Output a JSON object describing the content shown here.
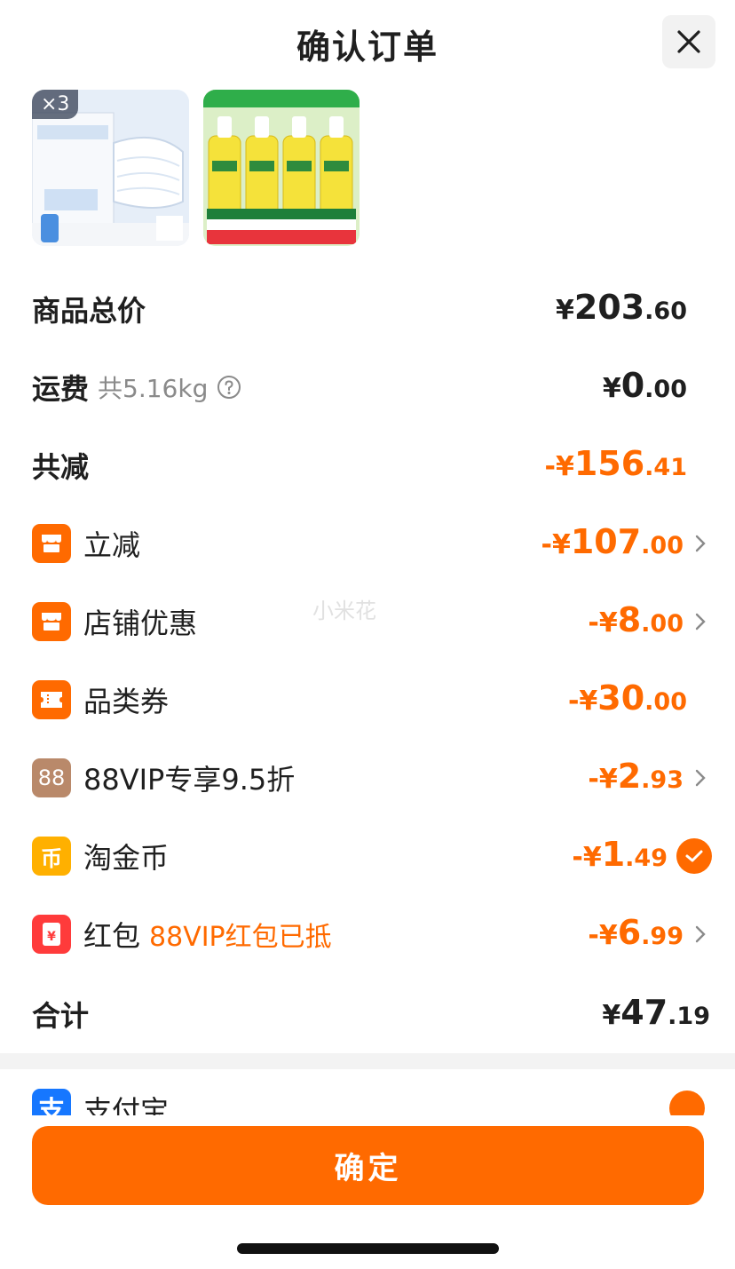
{
  "header": {
    "title": "确认订单",
    "close_icon": "close-icon"
  },
  "products": [
    {
      "qty_badge": "×3",
      "colors": {
        "bg": "#dfe9f6"
      }
    },
    {
      "colors": {
        "bg": "#9fd67a"
      }
    }
  ],
  "summary": {
    "goods_total": {
      "label": "商品总价",
      "currency": "¥",
      "int": "203",
      "dec": ".60"
    },
    "shipping": {
      "label": "运费",
      "weight": "共5.16kg",
      "currency": "¥",
      "int": "0",
      "dec": ".00"
    },
    "total_discount": {
      "label": "共减",
      "prefix": "-¥",
      "int": "156",
      "dec": ".41"
    }
  },
  "discounts": [
    {
      "label": "立减",
      "prefix": "-¥",
      "int": "107",
      "dec": ".00",
      "icon": "store-icon"
    },
    {
      "label": "店铺优惠",
      "prefix": "-¥",
      "int": "8",
      "dec": ".00",
      "icon": "store-icon"
    },
    {
      "label": "品类券",
      "prefix": "-¥",
      "int": "30",
      "dec": ".00",
      "icon": "ticket-icon"
    },
    {
      "label": "88VIP专享9.5折",
      "prefix": "-¥",
      "int": "2",
      "dec": ".93",
      "icon": "vip-88-icon",
      "icon_text": "88"
    },
    {
      "label": "淘金币",
      "prefix": "-¥",
      "int": "1",
      "dec": ".49",
      "icon": "coin-icon",
      "icon_text": "币"
    },
    {
      "label": "红包",
      "note": "88VIP红包已抵",
      "prefix": "-¥",
      "int": "6",
      "dec": ".99",
      "icon": "red-packet-icon",
      "icon_text": "¥"
    }
  ],
  "total": {
    "label": "合计",
    "currency": "¥",
    "int": "47",
    "dec": ".19"
  },
  "payment": {
    "label": "支付宝",
    "icon_text": "支"
  },
  "confirm_label": "确定",
  "watermark": "小米花",
  "colors": {
    "accent": "#ff6a00",
    "alipay": "#1677ff",
    "vip": "#b9896a",
    "coin": "#ffb000",
    "red": "#ff3b3b"
  }
}
